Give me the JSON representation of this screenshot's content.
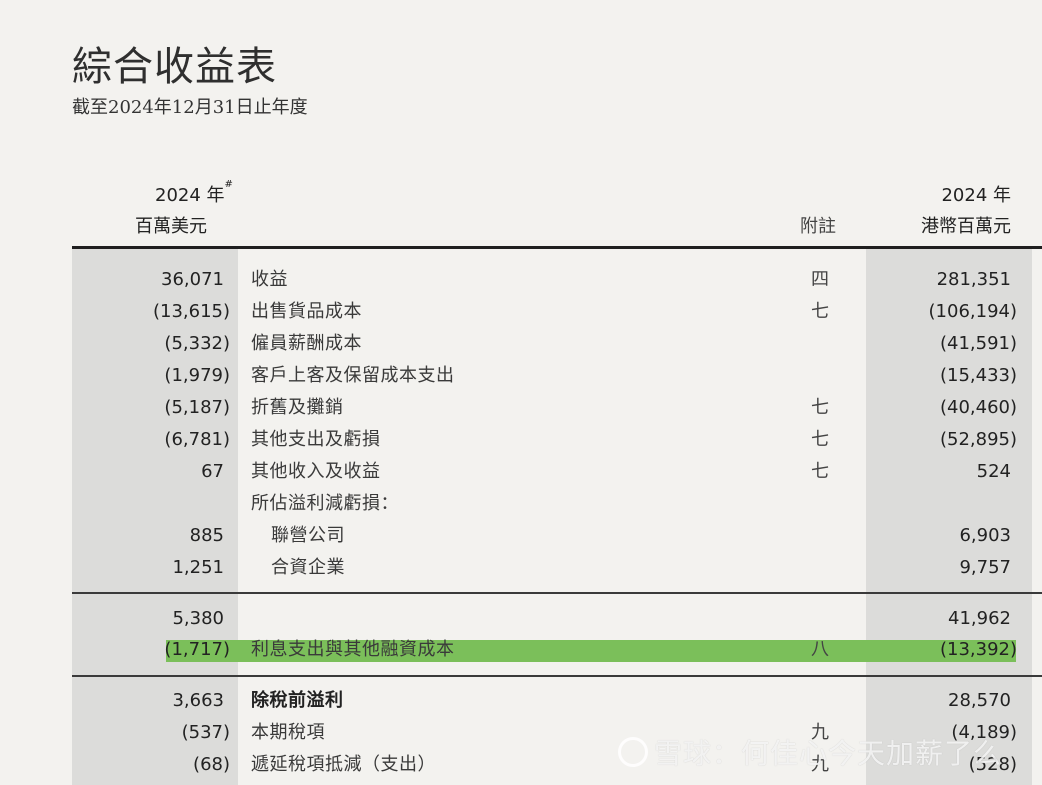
{
  "title": "綜合收益表",
  "subtitle": "截至2024年12月31日止年度",
  "headers": {
    "usd_year": "2024 年",
    "usd_mark": "#",
    "usd_unit": "百萬美元",
    "note": "附註",
    "hkd_year": "2024 年",
    "hkd_unit": "港幣百萬元"
  },
  "rows": [
    {
      "usd": "36,071",
      "label": "收益",
      "note": "四",
      "hkd": "281,351"
    },
    {
      "usd": "(13,615)",
      "label": "出售貨品成本",
      "note": "七",
      "hkd": "(106,194)"
    },
    {
      "usd": "(5,332)",
      "label": "僱員薪酬成本",
      "note": "",
      "hkd": "(41,591)"
    },
    {
      "usd": "(1,979)",
      "label": "客戶上客及保留成本支出",
      "note": "",
      "hkd": "(15,433)"
    },
    {
      "usd": "(5,187)",
      "label": "折舊及攤銷",
      "note": "七",
      "hkd": "(40,460)"
    },
    {
      "usd": "(6,781)",
      "label": "其他支出及虧損",
      "note": "七",
      "hkd": "(52,895)"
    },
    {
      "usd": "67",
      "label": "其他收入及收益",
      "note": "七",
      "hkd": "524"
    },
    {
      "usd": "",
      "label": "所佔溢利減虧損：",
      "note": "",
      "hkd": ""
    },
    {
      "usd": "885",
      "label": "聯營公司",
      "note": "",
      "hkd": "6,903"
    },
    {
      "usd": "1,251",
      "label": "合資企業",
      "note": "",
      "hkd": "9,757"
    },
    {
      "usd": "5,380",
      "label": "",
      "note": "",
      "hkd": "41,962"
    },
    {
      "usd": "(1,717)",
      "label": "利息支出與其他融資成本",
      "note": "八",
      "hkd": "(13,392)"
    },
    {
      "usd": "3,663",
      "label": "除稅前溢利",
      "note": "",
      "hkd": "28,570"
    },
    {
      "usd": "(537)",
      "label": "本期稅項",
      "note": "九",
      "hkd": "(4,189)"
    },
    {
      "usd": "(68)",
      "label": "遞延稅項抵減（支出）",
      "note": "九",
      "hkd": "(528)"
    }
  ],
  "watermark": "雪球：何佳心今天加薪了么",
  "colors": {
    "highlight": "#7bbf5a",
    "shaded_column": "#dcdcda",
    "background": "#f3f2ef"
  }
}
